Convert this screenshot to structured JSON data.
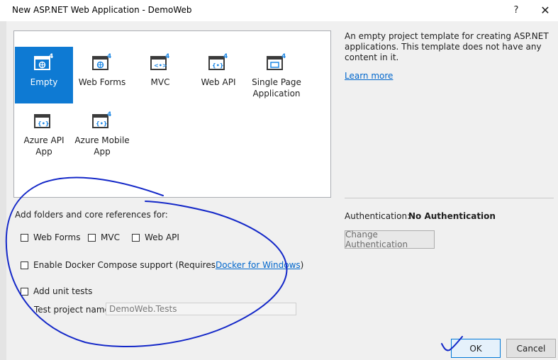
{
  "window": {
    "title": "New ASP.NET Web Application - DemoWeb",
    "help_glyph": "?",
    "close_glyph": "✕"
  },
  "templates": [
    {
      "label": "Empty",
      "selected": true
    },
    {
      "label": "Web Forms",
      "selected": false
    },
    {
      "label": "MVC",
      "selected": false
    },
    {
      "label": "Web API",
      "selected": false
    },
    {
      "label": "Single Page Application",
      "selected": false
    },
    {
      "label": "Azure API App",
      "selected": false
    },
    {
      "label": "Azure Mobile App",
      "selected": false
    }
  ],
  "template_badge": "4",
  "description": {
    "text": "An empty project template for creating ASP.NET applications. This template does not have any content in it.",
    "learn_more": "Learn more"
  },
  "authentication": {
    "label": "Authentication:",
    "value": "No Authentication",
    "change_button": "Change Authentication"
  },
  "folders": {
    "label": "Add folders and core references for:",
    "web_forms": "Web Forms",
    "mvc": "MVC",
    "web_api": "Web API"
  },
  "docker": {
    "label_prefix": "Enable Docker Compose support (Requires ",
    "link": "Docker for Windows",
    "label_suffix": ")"
  },
  "unit_tests": {
    "label": "Add unit tests",
    "project_name_label": "Test project name:",
    "project_name_value": "DemoWeb.Tests"
  },
  "buttons": {
    "ok": "OK",
    "cancel": "Cancel"
  },
  "colors": {
    "accent": "#0e7ad3",
    "link": "#0066cc",
    "annotation_ink": "#1428c8"
  }
}
